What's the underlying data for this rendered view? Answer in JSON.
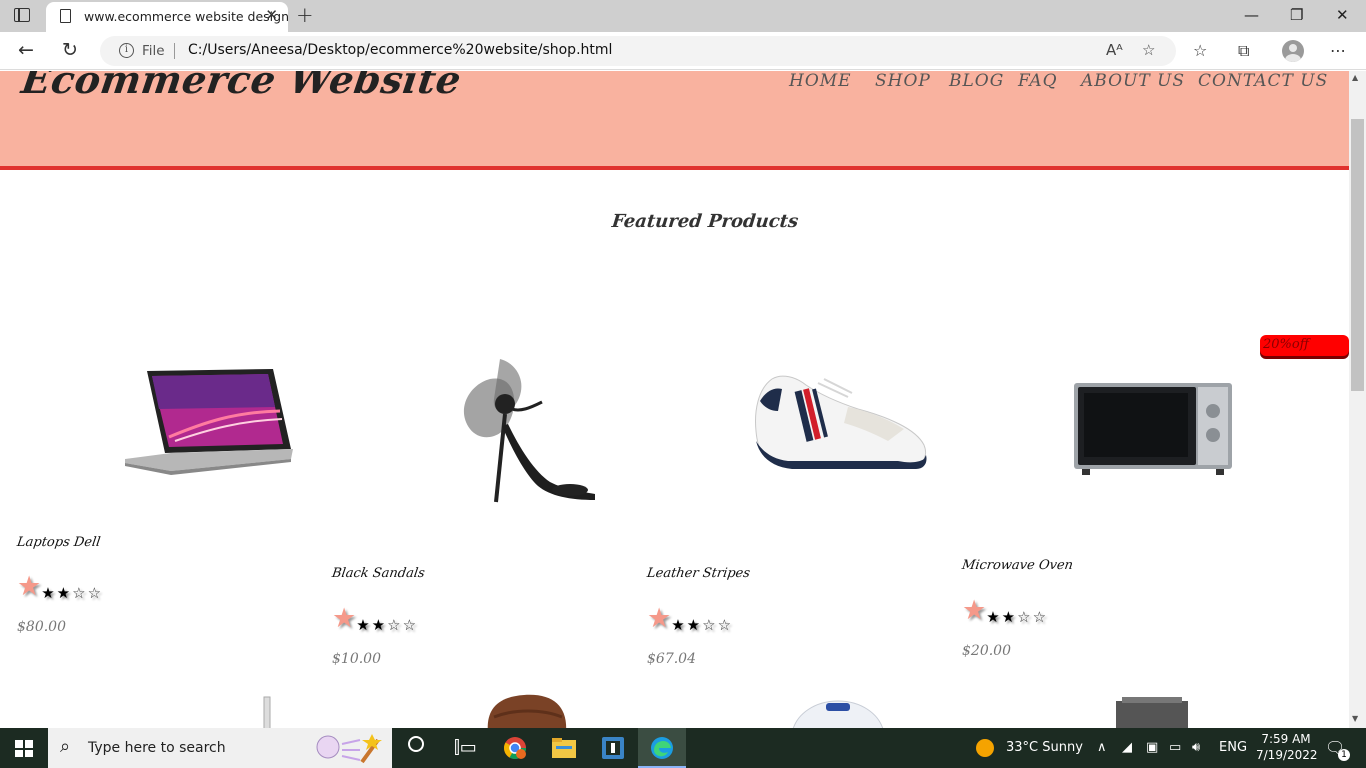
{
  "browser": {
    "tab_title": "www.ecommerce website design",
    "close_tab": "✕",
    "new_tab": "+",
    "file_label": "File",
    "url": "C:/Users/Aneesa/Desktop/ecommerce%20website/shop.html"
  },
  "site": {
    "logo": "Ecommerce Website",
    "menu": [
      "HOME",
      "SHOP",
      "BLOG",
      "FAQ",
      "ABOUT US",
      "CONTACT US"
    ],
    "section_title": "Featured Products",
    "sale_badge": "20%off",
    "products": [
      {
        "name": "Laptops Dell",
        "price": "$80.00",
        "rating": 2,
        "max_rating": 5
      },
      {
        "name": "Black Sandals",
        "price": "$10.00",
        "rating": 2,
        "max_rating": 5
      },
      {
        "name": "Leather Stripes",
        "price": "$67.04",
        "rating": 2,
        "max_rating": 5
      },
      {
        "name": "Microwave Oven",
        "price": "$20.00",
        "rating": 2,
        "max_rating": 5
      }
    ]
  },
  "taskbar": {
    "search_placeholder": "Type here to search",
    "weather": "33°C  Sunny",
    "language": "ENG",
    "time": "7:59 AM",
    "date": "7/19/2022",
    "notification_count": "1"
  }
}
